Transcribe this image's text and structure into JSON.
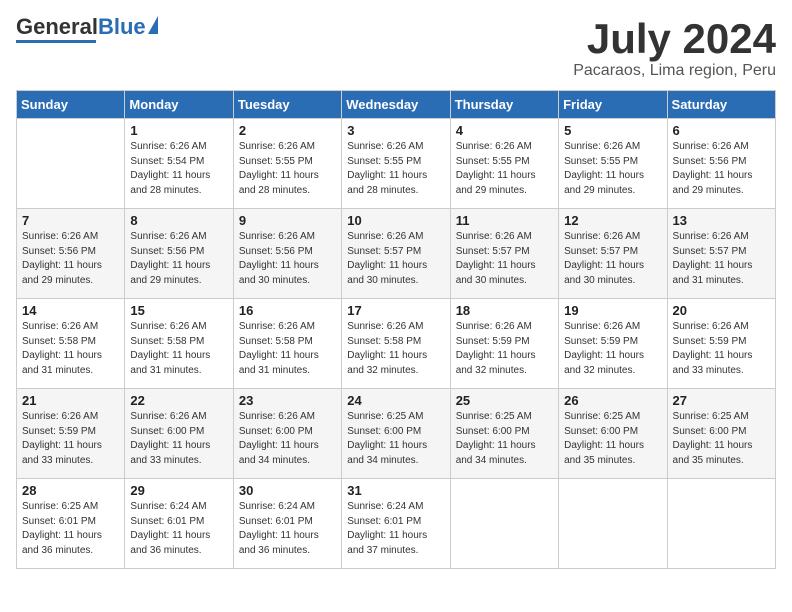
{
  "header": {
    "logo_general": "General",
    "logo_blue": "Blue",
    "month_title": "July 2024",
    "location": "Pacaraos, Lima region, Peru"
  },
  "days_of_week": [
    "Sunday",
    "Monday",
    "Tuesday",
    "Wednesday",
    "Thursday",
    "Friday",
    "Saturday"
  ],
  "weeks": [
    [
      {
        "day": "",
        "info": ""
      },
      {
        "day": "1",
        "info": "Sunrise: 6:26 AM\nSunset: 5:54 PM\nDaylight: 11 hours\nand 28 minutes."
      },
      {
        "day": "2",
        "info": "Sunrise: 6:26 AM\nSunset: 5:55 PM\nDaylight: 11 hours\nand 28 minutes."
      },
      {
        "day": "3",
        "info": "Sunrise: 6:26 AM\nSunset: 5:55 PM\nDaylight: 11 hours\nand 28 minutes."
      },
      {
        "day": "4",
        "info": "Sunrise: 6:26 AM\nSunset: 5:55 PM\nDaylight: 11 hours\nand 29 minutes."
      },
      {
        "day": "5",
        "info": "Sunrise: 6:26 AM\nSunset: 5:55 PM\nDaylight: 11 hours\nand 29 minutes."
      },
      {
        "day": "6",
        "info": "Sunrise: 6:26 AM\nSunset: 5:56 PM\nDaylight: 11 hours\nand 29 minutes."
      }
    ],
    [
      {
        "day": "7",
        "info": ""
      },
      {
        "day": "8",
        "info": "Sunrise: 6:26 AM\nSunset: 5:56 PM\nDaylight: 11 hours\nand 29 minutes."
      },
      {
        "day": "9",
        "info": "Sunrise: 6:26 AM\nSunset: 5:56 PM\nDaylight: 11 hours\nand 30 minutes."
      },
      {
        "day": "10",
        "info": "Sunrise: 6:26 AM\nSunset: 5:57 PM\nDaylight: 11 hours\nand 30 minutes."
      },
      {
        "day": "11",
        "info": "Sunrise: 6:26 AM\nSunset: 5:57 PM\nDaylight: 11 hours\nand 30 minutes."
      },
      {
        "day": "12",
        "info": "Sunrise: 6:26 AM\nSunset: 5:57 PM\nDaylight: 11 hours\nand 30 minutes."
      },
      {
        "day": "13",
        "info": "Sunrise: 6:26 AM\nSunset: 5:57 PM\nDaylight: 11 hours\nand 31 minutes."
      }
    ],
    [
      {
        "day": "14",
        "info": ""
      },
      {
        "day": "15",
        "info": "Sunrise: 6:26 AM\nSunset: 5:58 PM\nDaylight: 11 hours\nand 31 minutes."
      },
      {
        "day": "16",
        "info": "Sunrise: 6:26 AM\nSunset: 5:58 PM\nDaylight: 11 hours\nand 31 minutes."
      },
      {
        "day": "17",
        "info": "Sunrise: 6:26 AM\nSunset: 5:58 PM\nDaylight: 11 hours\nand 32 minutes."
      },
      {
        "day": "18",
        "info": "Sunrise: 6:26 AM\nSunset: 5:59 PM\nDaylight: 11 hours\nand 32 minutes."
      },
      {
        "day": "19",
        "info": "Sunrise: 6:26 AM\nSunset: 5:59 PM\nDaylight: 11 hours\nand 32 minutes."
      },
      {
        "day": "20",
        "info": "Sunrise: 6:26 AM\nSunset: 5:59 PM\nDaylight: 11 hours\nand 33 minutes."
      }
    ],
    [
      {
        "day": "21",
        "info": ""
      },
      {
        "day": "22",
        "info": "Sunrise: 6:26 AM\nSunset: 6:00 PM\nDaylight: 11 hours\nand 33 minutes."
      },
      {
        "day": "23",
        "info": "Sunrise: 6:26 AM\nSunset: 6:00 PM\nDaylight: 11 hours\nand 34 minutes."
      },
      {
        "day": "24",
        "info": "Sunrise: 6:25 AM\nSunset: 6:00 PM\nDaylight: 11 hours\nand 34 minutes."
      },
      {
        "day": "25",
        "info": "Sunrise: 6:25 AM\nSunset: 6:00 PM\nDaylight: 11 hours\nand 34 minutes."
      },
      {
        "day": "26",
        "info": "Sunrise: 6:25 AM\nSunset: 6:00 PM\nDaylight: 11 hours\nand 35 minutes."
      },
      {
        "day": "27",
        "info": "Sunrise: 6:25 AM\nSunset: 6:00 PM\nDaylight: 11 hours\nand 35 minutes."
      }
    ],
    [
      {
        "day": "28",
        "info": "Sunrise: 6:25 AM\nSunset: 6:01 PM\nDaylight: 11 hours\nand 36 minutes."
      },
      {
        "day": "29",
        "info": "Sunrise: 6:24 AM\nSunset: 6:01 PM\nDaylight: 11 hours\nand 36 minutes."
      },
      {
        "day": "30",
        "info": "Sunrise: 6:24 AM\nSunset: 6:01 PM\nDaylight: 11 hours\nand 36 minutes."
      },
      {
        "day": "31",
        "info": "Sunrise: 6:24 AM\nSunset: 6:01 PM\nDaylight: 11 hours\nand 37 minutes."
      },
      {
        "day": "",
        "info": ""
      },
      {
        "day": "",
        "info": ""
      },
      {
        "day": "",
        "info": ""
      }
    ]
  ],
  "week_7_sunday_info": "Sunrise: 6:26 AM\nSunset: 5:56 PM\nDaylight: 11 hours\nand 29 minutes.",
  "week_14_sunday_info": "Sunrise: 6:26 AM\nSunset: 5:58 PM\nDaylight: 11 hours\nand 31 minutes.",
  "week_21_sunday_info": "Sunrise: 6:26 AM\nSunset: 5:59 PM\nDaylight: 11 hours\nand 33 minutes."
}
